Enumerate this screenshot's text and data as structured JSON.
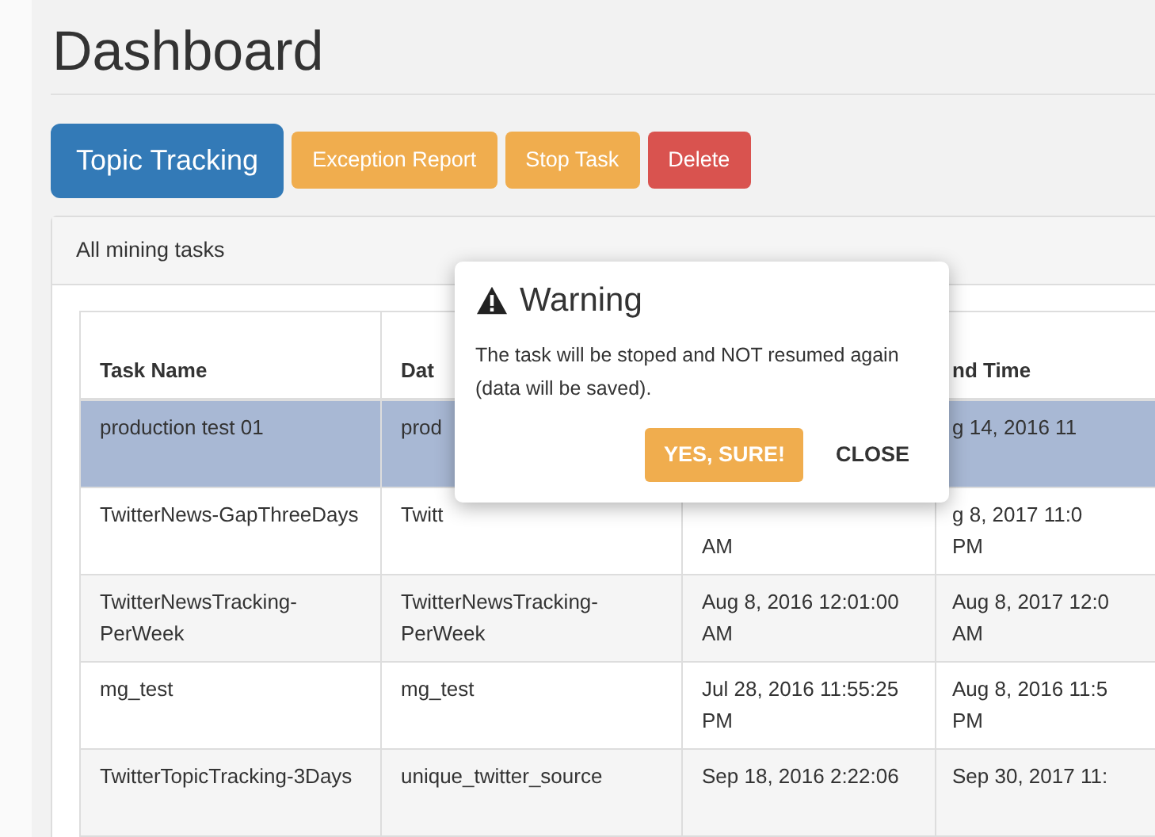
{
  "page": {
    "title": "Dashboard"
  },
  "buttons": [
    {
      "label": "Topic Tracking",
      "kind": "primary"
    },
    {
      "label": "Exception Report",
      "kind": "warning"
    },
    {
      "label": "Stop Task",
      "kind": "warning"
    },
    {
      "label": "Delete",
      "kind": "danger"
    }
  ],
  "panel": {
    "title": "All mining tasks"
  },
  "table": {
    "columns": [
      "Task Name",
      "Dat",
      null,
      "nd Time"
    ],
    "rows": [
      {
        "selected": true,
        "cells": [
          [
            "production test 01"
          ],
          [
            "prod"
          ],
          null,
          [
            "g 14, 2016 11"
          ]
        ]
      },
      {
        "selected": false,
        "cells": [
          [
            "TwitterNews-GapThreeDays"
          ],
          [
            "Twitt"
          ],
          [
            null,
            "AM"
          ],
          [
            "g 8, 2017 11:0",
            "PM"
          ]
        ]
      },
      {
        "selected": false,
        "cells": [
          [
            "TwitterNewsTracking-",
            "PerWeek"
          ],
          [
            "TwitterNewsTracking-",
            "PerWeek"
          ],
          [
            "Aug 8, 2016 12:01:00",
            "AM"
          ],
          [
            "Aug 8, 2017 12:0",
            "AM"
          ]
        ]
      },
      {
        "selected": false,
        "cells": [
          [
            "mg_test"
          ],
          [
            "mg_test"
          ],
          [
            "Jul 28, 2016 11:55:25",
            "PM"
          ],
          [
            "Aug 8, 2016 11:5",
            "PM"
          ]
        ]
      },
      {
        "selected": false,
        "cells": [
          [
            "TwitterTopicTracking-3Days"
          ],
          [
            "unique_twitter_source"
          ],
          [
            "Sep 18, 2016 2:22:06"
          ],
          [
            "Sep 30, 2017 11:"
          ]
        ]
      }
    ]
  },
  "dialog": {
    "title": "Warning",
    "message": "The task will be stoped and NOT resumed again (data will be saved).",
    "buttons": [
      {
        "label": "YES, SURE!",
        "kind": "confirm"
      },
      {
        "label": "CLOSE",
        "kind": "plain"
      }
    ]
  }
}
